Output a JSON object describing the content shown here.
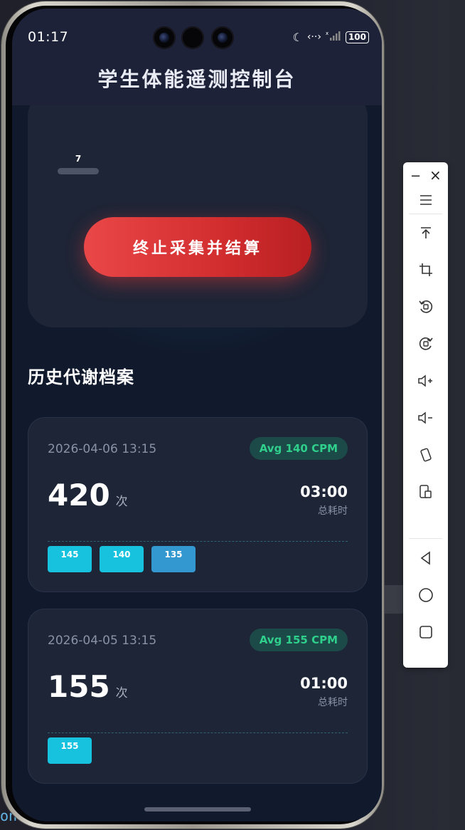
{
  "status_bar": {
    "time": "01:17",
    "battery": "100"
  },
  "app": {
    "title": "学生体能遥测控制台"
  },
  "control": {
    "beat_label": "7",
    "stop_button_label": "终止采集并结算"
  },
  "history": {
    "title": "历史代谢档案",
    "records": [
      {
        "date": "2026-04-06 13:15",
        "badge": "Avg 140 CPM",
        "count": "420",
        "count_unit": "次",
        "duration": "03:00",
        "duration_label": "总耗时",
        "chips": [
          "145",
          "140",
          "135"
        ]
      },
      {
        "date": "2026-04-05 13:15",
        "badge": "Avg 155 CPM",
        "count": "155",
        "count_unit": "次",
        "duration": "01:00",
        "duration_label": "总耗时",
        "chips": [
          "155"
        ]
      }
    ]
  },
  "desktop": {
    "partial_text": "on"
  },
  "toolbar": {
    "items": [
      "minimize-icon",
      "close-icon",
      "menu-icon",
      "pin-top-icon",
      "crop-icon",
      "rotate-left-icon",
      "rotate-right-icon",
      "volume-up-icon",
      "volume-down-icon",
      "shake-icon",
      "screenshot-icon",
      "back-icon",
      "home-icon",
      "recents-icon"
    ]
  },
  "colors": {
    "accent_red": "#e23a3c",
    "chip_cyan": "#16c2dd",
    "chip_blue": "#3397d0",
    "badge_green": "#2fcf8c",
    "card_bg": "#1d2537",
    "screen_bg": "#111a2d"
  }
}
